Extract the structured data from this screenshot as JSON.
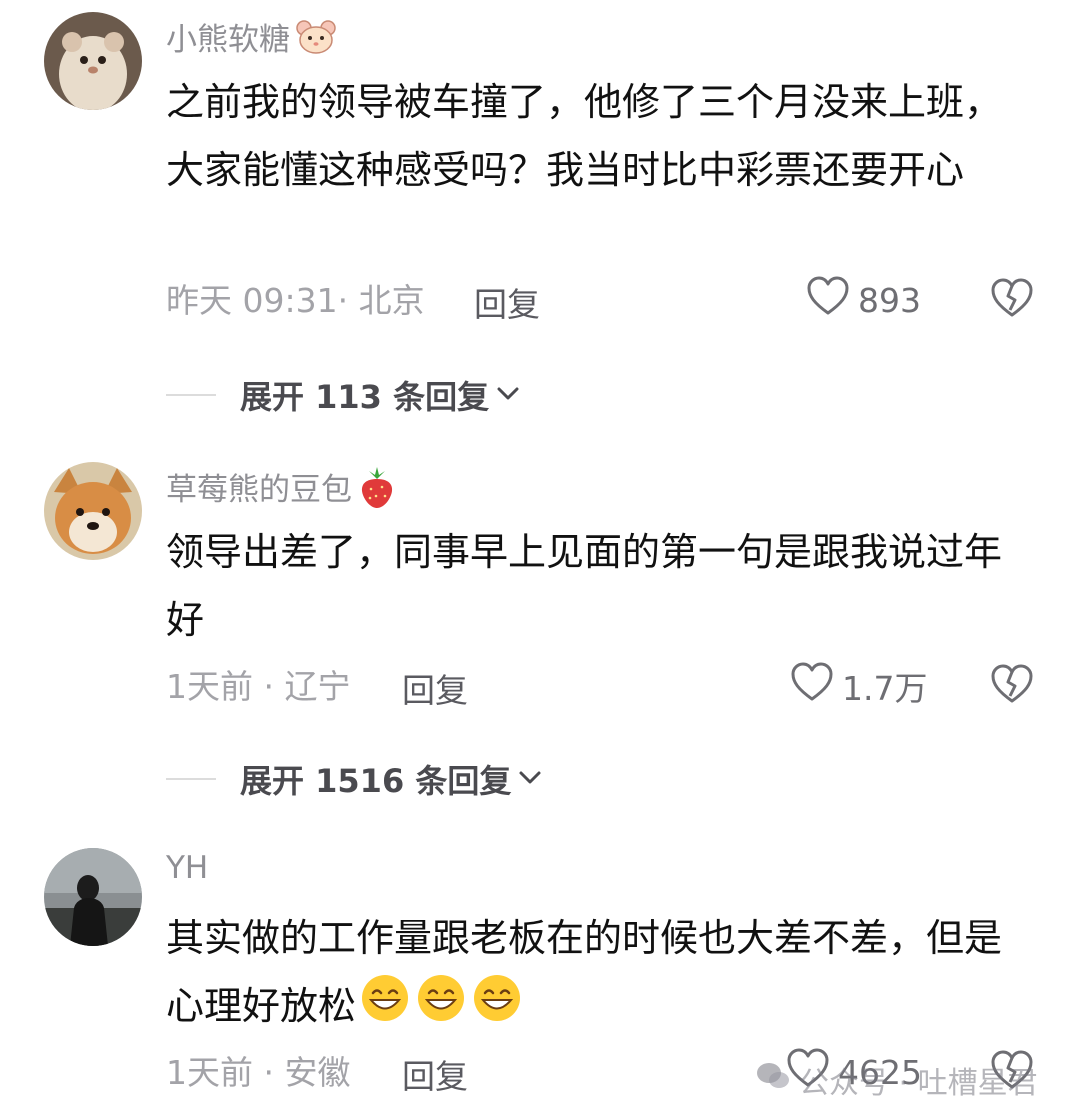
{
  "comments": [
    {
      "username": "小熊软糖",
      "username_emoji": "hamster-face-icon",
      "text": "之前我的领导被车撞了，他修了三个月没来上班，大家能懂这种感受吗？我当时比中彩票还要开心",
      "time_location": "昨天 09:31· 北京",
      "reply_label": "回复",
      "likes": "893",
      "expand_label": "展开 113 条回复"
    },
    {
      "username": "草莓熊的豆包",
      "username_emoji": "strawberry-icon",
      "text": "领导出差了，同事早上见面的第一句是跟我说过年好",
      "time_location": "1天前 · 辽宁",
      "reply_label": "回复",
      "likes": "1.7万",
      "expand_label": "展开 1516 条回复"
    },
    {
      "username": "YH",
      "text": "其实做的工作量跟老板在的时候也大差不差，但是心理好放松",
      "time_location": "1天前 · 安徽",
      "reply_label": "回复",
      "likes": "4625"
    }
  ],
  "watermark": "公众号 · 吐槽星君",
  "colors": {
    "text": "#111111",
    "meta": "#a3a3a8",
    "username": "#8f8f94"
  }
}
